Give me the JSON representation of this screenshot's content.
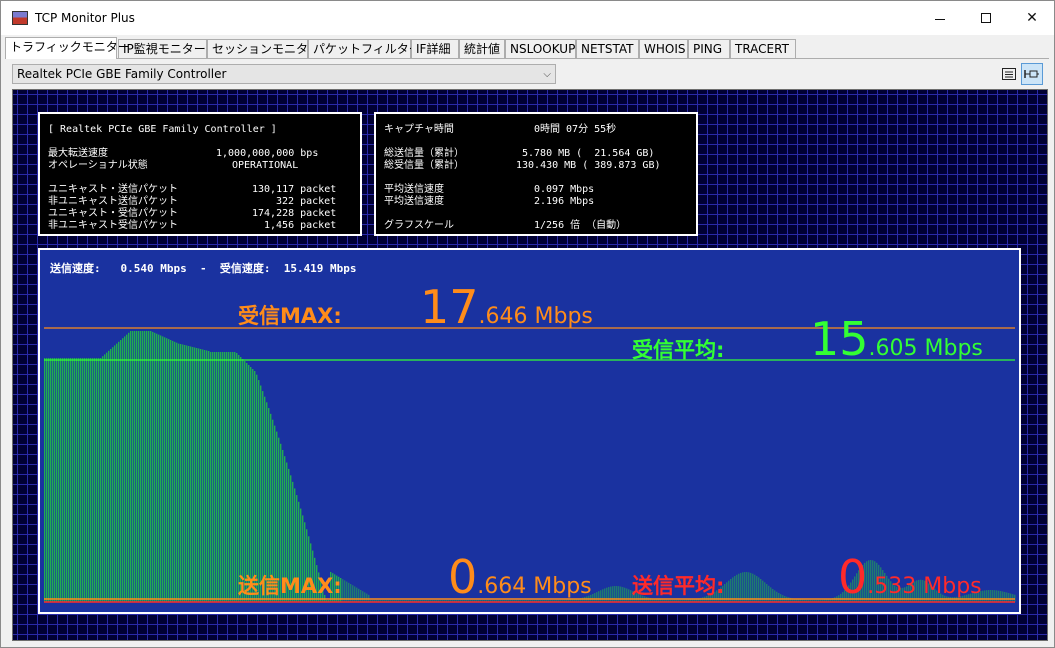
{
  "window": {
    "title": "TCP Monitor Plus",
    "minimize": "—",
    "maximize": "☐",
    "close": "✕"
  },
  "tabs": [
    {
      "label": "トラフィックモニター",
      "active": true
    },
    {
      "label": "IP監視モニター"
    },
    {
      "label": "セッションモニター"
    },
    {
      "label": "パケットフィルター"
    },
    {
      "label": "IF詳細"
    },
    {
      "label": "統計値"
    },
    {
      "label": "NSLOOKUP"
    },
    {
      "label": "NETSTAT"
    },
    {
      "label": "WHOIS"
    },
    {
      "label": "PING"
    },
    {
      "label": "TRACERT"
    }
  ],
  "toolbar": {
    "adapter_value": "Realtek PCIe GBE Family Controller",
    "list_icon": "list-icon",
    "pin_icon": "pin-icon"
  },
  "info_left": {
    "adapter": "[ Realtek PCIe GBE Family Controller ]",
    "max_speed_label": "最大転送速度",
    "max_speed_value": "1,000,000,000 bps",
    "op_state_label": "オペレーショナル状態",
    "op_state_value": "OPERATIONAL",
    "unicast_sent_label": "ユニキャスト・送信パケット",
    "unicast_sent_value": "130,117 packet",
    "nonunicast_sent_label": "非ユニキャスト送信パケット",
    "nonunicast_sent_value": "322 packet",
    "unicast_recv_label": "ユニキャスト・受信パケット",
    "unicast_recv_value": "174,228 packet",
    "nonunicast_recv_label": "非ユニキャスト受信パケット",
    "nonunicast_recv_value": "1,456 packet"
  },
  "info_right": {
    "capture_label": "キャプチャ時間",
    "capture_value": "0時間 07分 55秒",
    "total_sent_label": "総送信量（累計）",
    "total_sent_value": "5.780 MB (  21.564 GB)",
    "total_recv_label": "総受信量（累計）",
    "total_recv_value": "130.430 MB ( 389.873 GB)",
    "avg_send_label": "平均送信速度",
    "avg_send_value": "0.097 Mbps",
    "avg_send2_label": "平均送信速度",
    "avg_send2_value": "2.196 Mbps",
    "scale_label": "グラフスケール",
    "scale_value": "1/256 倍 （自動）"
  },
  "graph": {
    "speed_text": "送信速度:   0.540 Mbps  -  受信速度:  15.419 Mbps",
    "recv_max_label": "受信MAX:",
    "recv_max_int": "17",
    "recv_max_frac": ".646 Mbps",
    "recv_avg_label": "受信平均:",
    "recv_avg_int": "15",
    "recv_avg_frac": ".605 Mbps",
    "send_max_label": "送信MAX:",
    "send_max_int": "0",
    "send_max_frac": ".664 Mbps",
    "send_avg_label": "送信平均:",
    "send_avg_int": "0",
    "send_avg_frac": ".533 Mbps",
    "colors": {
      "recv_max": "#ff8c1a",
      "recv_avg": "#33ff33",
      "send_max": "#ff8c1a",
      "send_avg": "#ff2a2a",
      "bars": "#22b84a",
      "panel": "#1a32a0"
    }
  }
}
